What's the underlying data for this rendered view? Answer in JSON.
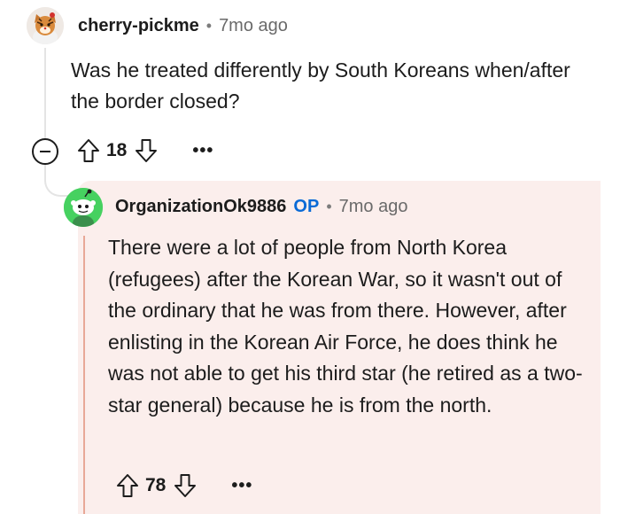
{
  "parent": {
    "username": "cherry-pickme",
    "separator": "•",
    "time": "7mo ago",
    "body": "Was he treated differently by South Koreans when/after the border closed?",
    "votes": "18",
    "more": "•••",
    "icons": {
      "avatar": "tiger-avatar",
      "upvote": "upvote-arrow-icon",
      "downvote": "downvote-arrow-icon",
      "collapse": "collapse-minus-icon"
    }
  },
  "reply": {
    "username": "OrganizationOk9886",
    "op_label": "OP",
    "separator": "•",
    "time": "7mo ago",
    "body": "There were a lot of people from North Korea (refugees) after the Korean War, so it wasn't out of the ordinary that he was from there. However, after enlisting in the Korean Air Force, he does think he was not able to get his third star (he retired as a two-star general) because he is from the north.",
    "votes": "78",
    "more": "•••",
    "icons": {
      "avatar": "snoo-avatar",
      "upvote": "upvote-arrow-icon",
      "downvote": "downvote-arrow-icon"
    }
  },
  "colors": {
    "highlight_bg": "#fbeeec",
    "highlight_line": "#e8a897",
    "op_blue": "#0a6ad6",
    "avatar_green": "#46d160"
  }
}
